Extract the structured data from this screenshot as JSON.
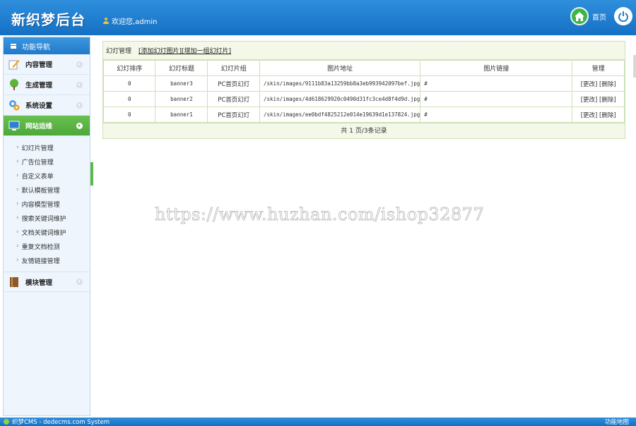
{
  "header": {
    "logo": "新织梦后台",
    "welcome": "欢迎您,admin",
    "home_label": "首页"
  },
  "sidebar": {
    "title": "功能导航",
    "items": [
      {
        "label": "内容管理"
      },
      {
        "label": "生成管理"
      },
      {
        "label": "系统设置"
      },
      {
        "label": "网站运维"
      }
    ],
    "sub_items": [
      "幻灯片管理",
      "广告位管理",
      "自定义表单",
      "默认模板管理",
      "内容模型管理",
      "搜索关键词维护",
      "文档关键词维护",
      "重复文档检测",
      "友情链接管理"
    ],
    "last_item": "模块管理"
  },
  "panel": {
    "title": "幻灯管理",
    "link_add_image": "[添加幻灯图片]",
    "link_add_group": "[增加一组幻灯片]",
    "columns": [
      "幻灯排序",
      "幻灯标题",
      "幻灯片组",
      "图片地址",
      "图片链接",
      "管理"
    ],
    "rows": [
      {
        "order": "0",
        "title": "banner3",
        "group": "PC首页幻灯",
        "image": "/skin/images/9111b83a13259bb8a3eb993942097bef.jpg",
        "link": "#",
        "edit": "[更改]",
        "delete": "[删除]"
      },
      {
        "order": "0",
        "title": "banner2",
        "group": "PC首页幻灯",
        "image": "/skin/images/4d618629920c0490d31fc3ce4d8f4d9d.jpg",
        "link": "#",
        "edit": "[更改]",
        "delete": "[删除]"
      },
      {
        "order": "0",
        "title": "banner1",
        "group": "PC首页幻灯",
        "image": "/skin/images/ee0bdf4825212e014e19639d1e137824.jpg",
        "link": "#",
        "edit": "[更改]",
        "delete": "[删除]"
      }
    ],
    "pager": "共 1 页/3条记录"
  },
  "watermark": "https://www.huzhan.com/ishop32877",
  "footer": {
    "left": "织梦CMS - dedecms.com System",
    "right": "功能地图"
  },
  "colors": {
    "header_blue": "#1f80d2",
    "active_green": "#4ea83a",
    "table_border": "#cfe0b8"
  }
}
